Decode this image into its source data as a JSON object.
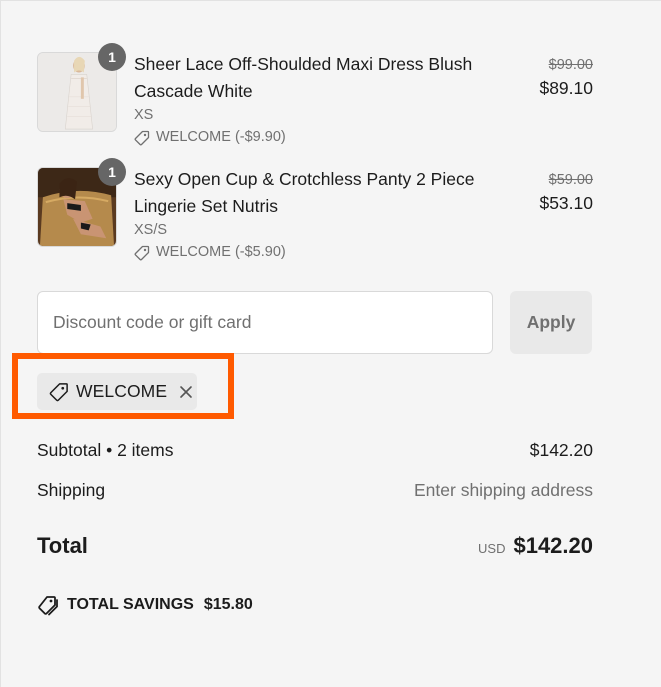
{
  "items": [
    {
      "quantity": "1",
      "title": "Sheer Lace Off-Shoulded Maxi Dress Blush Cascade White",
      "variant": "XS",
      "discount": "WELCOME (-$9.90)",
      "compare_price": "$99.00",
      "price": "$89.10",
      "image_icon": "dress-product-image"
    },
    {
      "quantity": "1",
      "title": "Sexy Open Cup & Crotchless Panty 2 Piece Lingerie Set Nutris",
      "variant": "XS/S",
      "discount": "WELCOME (-$5.90)",
      "compare_price": "$59.00",
      "price": "$53.10",
      "image_icon": "lingerie-product-image"
    }
  ],
  "discount_field": {
    "placeholder": "Discount code or gift card",
    "value": "",
    "apply_label": "Apply"
  },
  "applied_code": {
    "code": "WELCOME",
    "tag_icon": "tag-icon",
    "remove_icon": "close-icon"
  },
  "summary": {
    "subtotal_label": "Subtotal • 2 items",
    "subtotal_value": "$142.20",
    "shipping_label": "Shipping",
    "shipping_value": "Enter shipping address",
    "total_label": "Total",
    "currency": "USD",
    "total_value": "$142.20"
  },
  "savings": {
    "label": "TOTAL SAVINGS",
    "amount": "$15.80"
  },
  "colors": {
    "highlight": "#ff5a00",
    "badge": "#666666",
    "muted_text": "#707070",
    "background": "#f5f5f5"
  }
}
